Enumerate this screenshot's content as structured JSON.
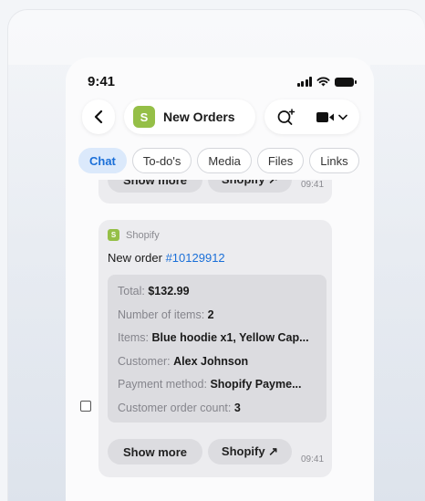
{
  "status_bar": {
    "time": "9:41"
  },
  "header": {
    "back_icon": "chevron-left-icon",
    "title": "New Orders",
    "logo_letter": "S",
    "search_icon": "search-sparkle-icon",
    "video_icon": "video-camera-icon",
    "dropdown_icon": "chevron-down-icon"
  },
  "tabs": [
    "Chat",
    "To-do's",
    "Media",
    "Files",
    "Links"
  ],
  "previous_message": {
    "show_more_label": "Show more",
    "shopify_label": "Shopify ↗",
    "time": "09:41"
  },
  "message": {
    "sender": "Shopify",
    "order_prefix": "New order ",
    "order_number": "#10129912",
    "details": [
      {
        "label": "Total: ",
        "value": "$132.99"
      },
      {
        "label": "Number of items: ",
        "value": "2"
      },
      {
        "label": "Items: ",
        "value": "Blue hoodie x1, Yellow Cap..."
      },
      {
        "label": "Customer: ",
        "value": "Alex Johnson"
      },
      {
        "label": "Payment method: ",
        "value": "Shopify Payme..."
      },
      {
        "label": "Customer order count: ",
        "value": "3"
      }
    ],
    "show_more_label": "Show more",
    "shopify_label": "Shopify ↗",
    "time": "09:41"
  },
  "colors": {
    "accent": "#1a6fd8",
    "shopify_green": "#95bf47",
    "active_tab_bg": "#dbe9fb"
  }
}
